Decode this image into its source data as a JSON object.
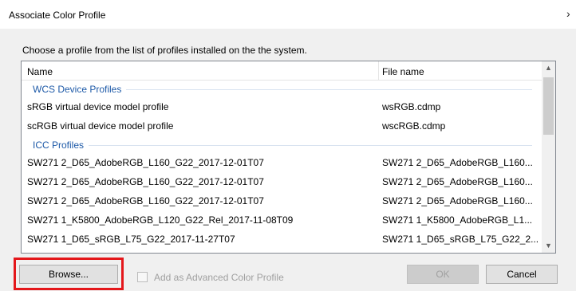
{
  "window": {
    "title": "Associate Color Profile",
    "close_glyph": "›"
  },
  "instruction": "Choose a profile from the list of profiles installed on the the system.",
  "list": {
    "columns": {
      "name": "Name",
      "file": "File name"
    },
    "groups": [
      {
        "label": "WCS Device Profiles",
        "rows": [
          {
            "name": "sRGB virtual device model profile",
            "file": "wsRGB.cdmp"
          },
          {
            "name": "scRGB virtual device model profile",
            "file": "wscRGB.cdmp"
          }
        ]
      },
      {
        "label": "ICC Profiles",
        "rows": [
          {
            "name": "SW271 2_D65_AdobeRGB_L160_G22_2017-12-01T07",
            "file": "SW271 2_D65_AdobeRGB_L160..."
          },
          {
            "name": "SW271 2_D65_AdobeRGB_L160_G22_2017-12-01T07",
            "file": "SW271 2_D65_AdobeRGB_L160..."
          },
          {
            "name": "SW271 2_D65_AdobeRGB_L160_G22_2017-12-01T07",
            "file": "SW271 2_D65_AdobeRGB_L160..."
          },
          {
            "name": "SW271 1_K5800_AdobeRGB_L120_G22_Rel_2017-11-08T09",
            "file": "SW271 1_K5800_AdobeRGB_L1..."
          },
          {
            "name": "SW271 1_D65_sRGB_L75_G22_2017-11-27T07",
            "file": "SW271 1_D65_sRGB_L75_G22_2..."
          }
        ]
      }
    ],
    "scroll_up_glyph": "▲",
    "scroll_down_glyph": "▼"
  },
  "buttons": {
    "browse": "Browse...",
    "ok": "OK",
    "cancel": "Cancel"
  },
  "checkbox": {
    "label": "Add as Advanced Color Profile",
    "checked": false,
    "enabled": false
  },
  "colors": {
    "group_label": "#1e5aa8",
    "highlight": "#e4171b"
  }
}
